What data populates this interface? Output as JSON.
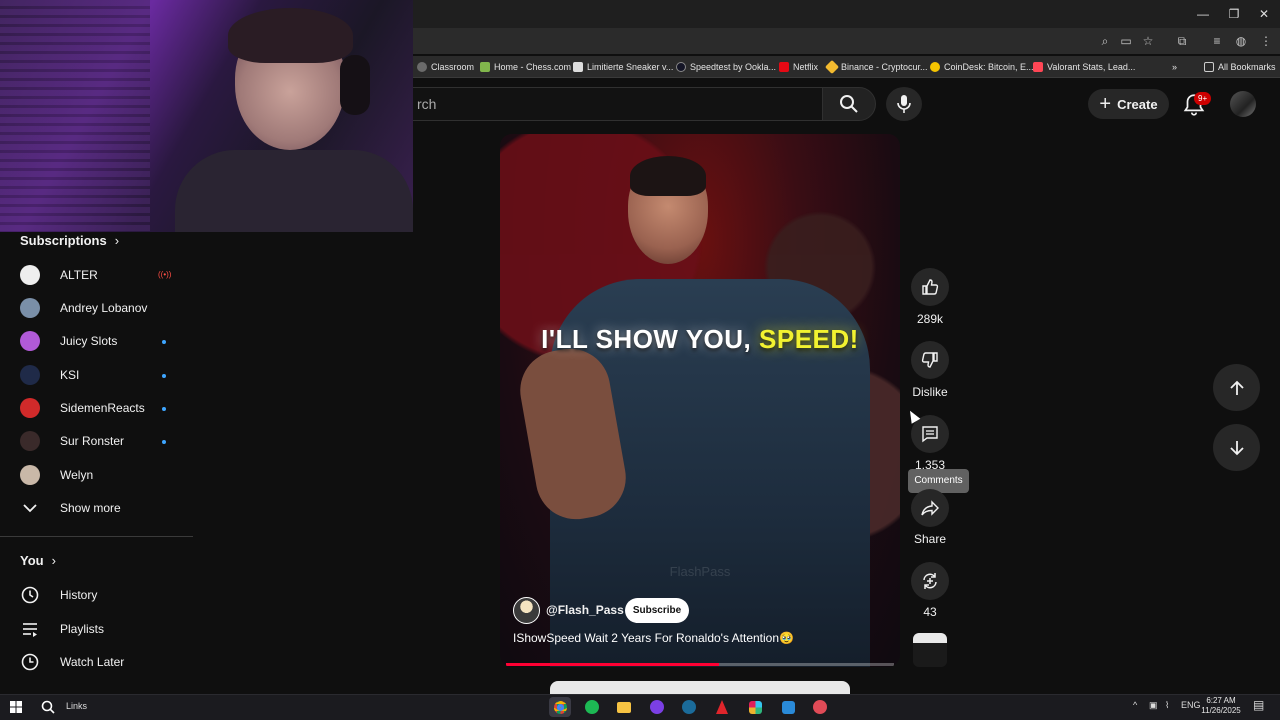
{
  "bookmarks": [
    {
      "label": "Classroom",
      "color": "#34a853"
    },
    {
      "label": "Home - Chess.com",
      "color": "#81b64c"
    },
    {
      "label": "Limitierte Sneaker v...",
      "color": "#dddddd"
    },
    {
      "label": "Speedtest by Ookla...",
      "color": "#141526"
    },
    {
      "label": "Netflix",
      "color": "#e50914"
    },
    {
      "label": "Binance - Cryptocur...",
      "color": "#f3ba2f"
    },
    {
      "label": "CoinDesk: Bitcoin, E...",
      "color": "#f5c400"
    },
    {
      "label": "Valorant Stats, Lead...",
      "color": "#ff4655"
    }
  ],
  "all_bookmarks": "All Bookmarks",
  "search": {
    "placeholder": "rch"
  },
  "header": {
    "create_label": "Create",
    "notif_count": "9+"
  },
  "sidebar": {
    "subscriptions_title": "Subscriptions",
    "subscriptions": [
      {
        "name": "ALTER",
        "status": "live",
        "avatar_color": "#eeeeee"
      },
      {
        "name": "Andrey Lobanov",
        "status": "",
        "avatar_color": "#7a8fa8"
      },
      {
        "name": "Juicy Slots",
        "status": "new",
        "avatar_color": "#b15ad8"
      },
      {
        "name": "KSI",
        "status": "new",
        "avatar_color": "#1f2a48"
      },
      {
        "name": "SidemenReacts",
        "status": "new",
        "avatar_color": "#d12a2a"
      },
      {
        "name": "Sur Ronster",
        "status": "new",
        "avatar_color": "#3a2a2a"
      },
      {
        "name": "Welyn",
        "status": "",
        "avatar_color": "#c9b8a8"
      }
    ],
    "show_more": "Show more",
    "you_title": "You",
    "you_items": [
      {
        "label": "History",
        "icon": "history-icon"
      },
      {
        "label": "Playlists",
        "icon": "playlists-icon"
      },
      {
        "label": "Watch Later",
        "icon": "watch-later-icon"
      }
    ]
  },
  "short": {
    "caption_main": "I'LL SHOW YOU,",
    "caption_highlight": "SPEED!",
    "watermark": "FlashPass",
    "channel": "@Flash_Pass",
    "subscribe_label": "Subscribe",
    "title": "IShowSpeed Wait 2 Years For Ronaldo's Attention🥹",
    "progress": 0.55
  },
  "actions": {
    "likes": "289k",
    "dislike_label": "Dislike",
    "comments": "1,353",
    "comments_tooltip": "Comments",
    "share_label": "Share",
    "remix_count": "43"
  },
  "taskbar": {
    "search_label": "Links",
    "lang": "ENG",
    "time": "6:27 AM",
    "date": "11/26/2025"
  }
}
